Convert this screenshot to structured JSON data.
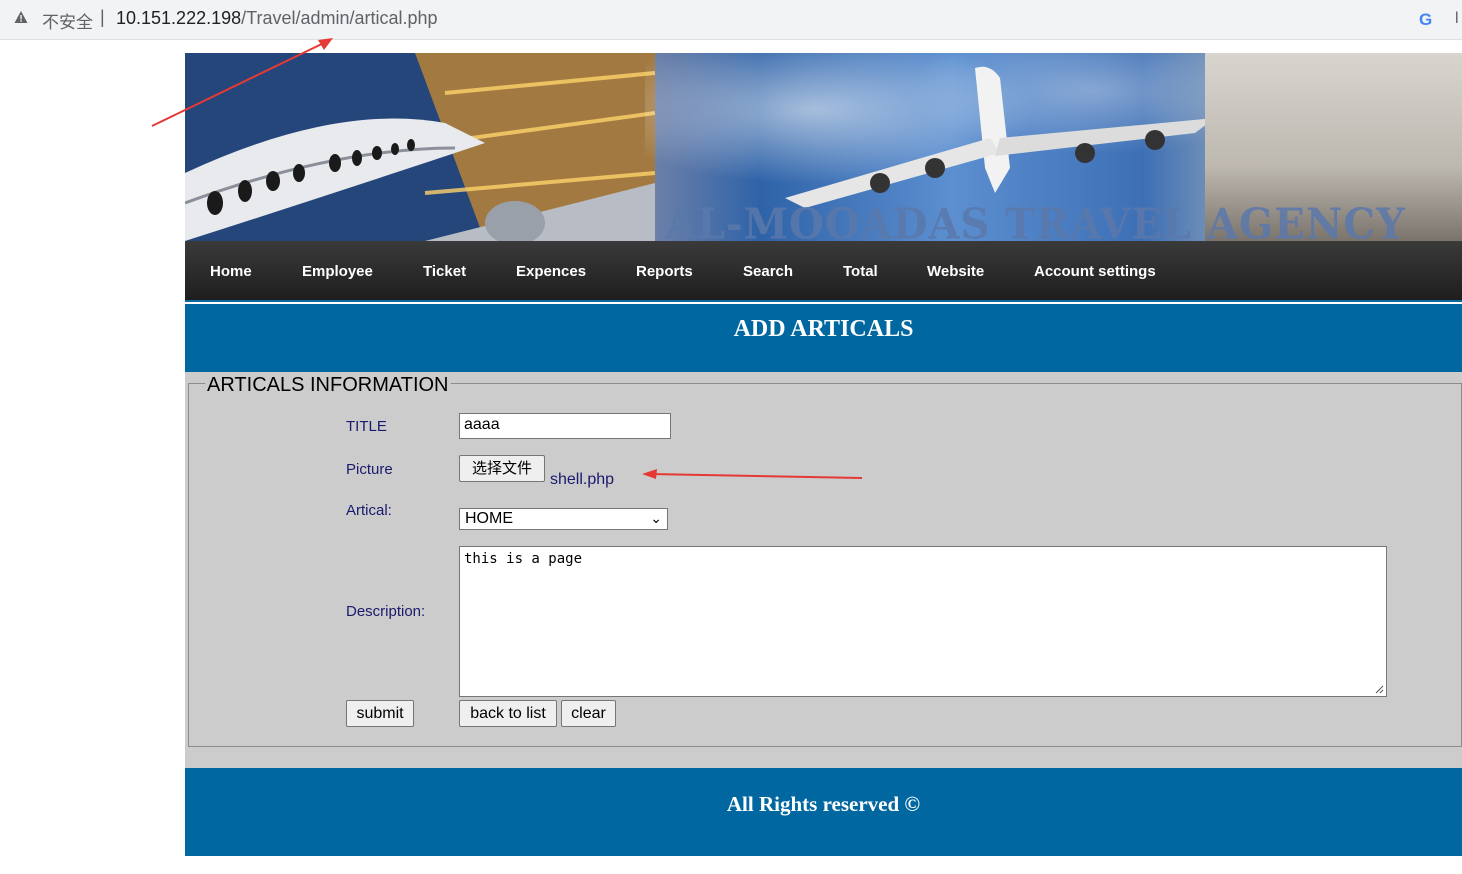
{
  "browser": {
    "security_label": "不安全",
    "separator": "|",
    "url_host": "10.151.222.198",
    "url_path": "/Travel/admin/artical.php",
    "icons": [
      "warning-triangle-icon",
      "google-icon"
    ]
  },
  "banner": {
    "title": "AL-MOOADAS TRAVEL AGENCY"
  },
  "nav": {
    "items": [
      "Home",
      "Employee",
      "Ticket",
      "Expences",
      "Reports",
      "Search",
      "Total",
      "Website",
      "Account settings"
    ]
  },
  "header": {
    "title": "ADD ARTICALS"
  },
  "form": {
    "legend": "ARTICALS INFORMATION",
    "title_label": "TITLE",
    "title_value": "aaaa",
    "picture_label": "Picture",
    "file_button": "选择文件",
    "file_name": "shell.php",
    "artical_label": "Artical:",
    "artical_selected": "HOME",
    "description_label": "Description:",
    "description_value": "this is a page",
    "submit_label": "submit",
    "back_label": "back to list",
    "clear_label": "clear"
  },
  "footer": {
    "text": "All Rights reserved ©"
  },
  "colors": {
    "blue_bar": "#0067a0",
    "nav_bg": "#1e1e1e",
    "form_bg": "#cccccc",
    "annotation_red": "#e53935"
  }
}
